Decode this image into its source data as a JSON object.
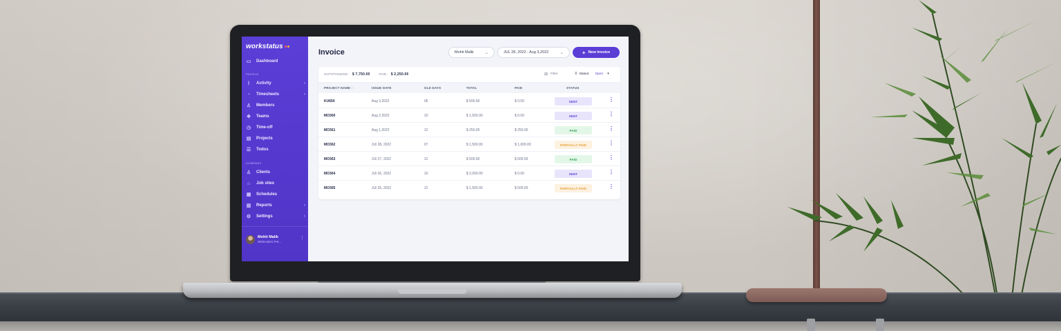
{
  "app": {
    "logo": "workstatus",
    "colors": {
      "brand": "#5a3ed6",
      "sent": "#5a3ed6",
      "paid": "#2e9b4e",
      "partial": "#e59a2b"
    }
  },
  "sidebar": {
    "top_item": {
      "label": "Dashboard",
      "icon": "dashboard-icon"
    },
    "sections": [
      {
        "title": "PEOPLE",
        "items": [
          {
            "label": "Activity",
            "icon": "activity-icon",
            "expandable": true
          },
          {
            "label": "Timesheets",
            "icon": "timesheets-icon",
            "expandable": true
          },
          {
            "label": "Members",
            "icon": "members-icon",
            "expandable": false
          },
          {
            "label": "Teams",
            "icon": "teams-icon",
            "expandable": false
          },
          {
            "label": "Time-off",
            "icon": "time-off-icon",
            "expandable": false
          },
          {
            "label": "Projects",
            "icon": "projects-icon",
            "expandable": false
          },
          {
            "label": "Todos",
            "icon": "todos-icon",
            "expandable": false
          }
        ]
      },
      {
        "title": "COMPANY",
        "items": [
          {
            "label": "Clients",
            "icon": "clients-icon",
            "expandable": false
          },
          {
            "label": "Job sites",
            "icon": "job-sites-icon",
            "expandable": false
          },
          {
            "label": "Schedules",
            "icon": "schedules-icon",
            "expandable": false
          },
          {
            "label": "Reports",
            "icon": "reports-icon",
            "expandable": true
          },
          {
            "label": "Settings",
            "icon": "settings-icon",
            "expandable": true
          }
        ]
      }
    ],
    "user": {
      "name": "Mohit Malik",
      "company": "Webcoders Pvt..."
    }
  },
  "header": {
    "title": "Invoice",
    "member_filter": "Mohit Malik",
    "date_range": "JUL 28, 2022 - Aug 3,2022",
    "new_button": "New Invoice"
  },
  "summary": {
    "outstanding_label": "OUTSTANDING :",
    "outstanding_value": "$ 7,750.00",
    "paid_label": "PAID :",
    "paid_value": "$ 2,250.00"
  },
  "toolbar": {
    "filter_label": "Filter",
    "status_label": "Status:",
    "status_value": "Open"
  },
  "table": {
    "columns": [
      "PROJECT NAME",
      "ISSUE DATE",
      "OLD DAYS",
      "TOTAL",
      "PAID",
      "STATUS"
    ],
    "sort_indicator": "↑",
    "rows": [
      {
        "project": "KU654",
        "issue_date": "Aug 3,2022",
        "old_days": "06",
        "total": "$ 500.00",
        "paid": "$ 0.00",
        "status": "SENT",
        "status_type": "sent"
      },
      {
        "project": "MO360",
        "issue_date": "Aug 2,2022",
        "old_days": "10",
        "total": "$ 1,500.00",
        "paid": "$ 0.00",
        "status": "SENT",
        "status_type": "sent"
      },
      {
        "project": "MO361",
        "issue_date": "Aug 1,2022",
        "old_days": "12",
        "total": "$ 250.00",
        "paid": "$ 250.00",
        "status": "PAID",
        "status_type": "paid"
      },
      {
        "project": "MO362",
        "issue_date": "JUl 28, 2022",
        "old_days": "07",
        "total": "$ 1,500.00",
        "paid": "$ 1,000.00",
        "status": "PARTIALLY PAID",
        "status_type": "partial"
      },
      {
        "project": "MO363",
        "issue_date": "JUl 27, 2022",
        "old_days": "12",
        "total": "$ 500.00",
        "paid": "$ 500.00",
        "status": "PAID",
        "status_type": "paid"
      },
      {
        "project": "MO364",
        "issue_date": "JUl 26, 2022",
        "old_days": "10",
        "total": "$ 2,000.00",
        "paid": "$ 0.00",
        "status": "SENT",
        "status_type": "sent"
      },
      {
        "project": "MO365",
        "issue_date": "JUl 25, 2022",
        "old_days": "12",
        "total": "$ 1,500.00",
        "paid": "$ 500.00",
        "status": "PARTIALLY PAID",
        "status_type": "partial"
      }
    ]
  }
}
